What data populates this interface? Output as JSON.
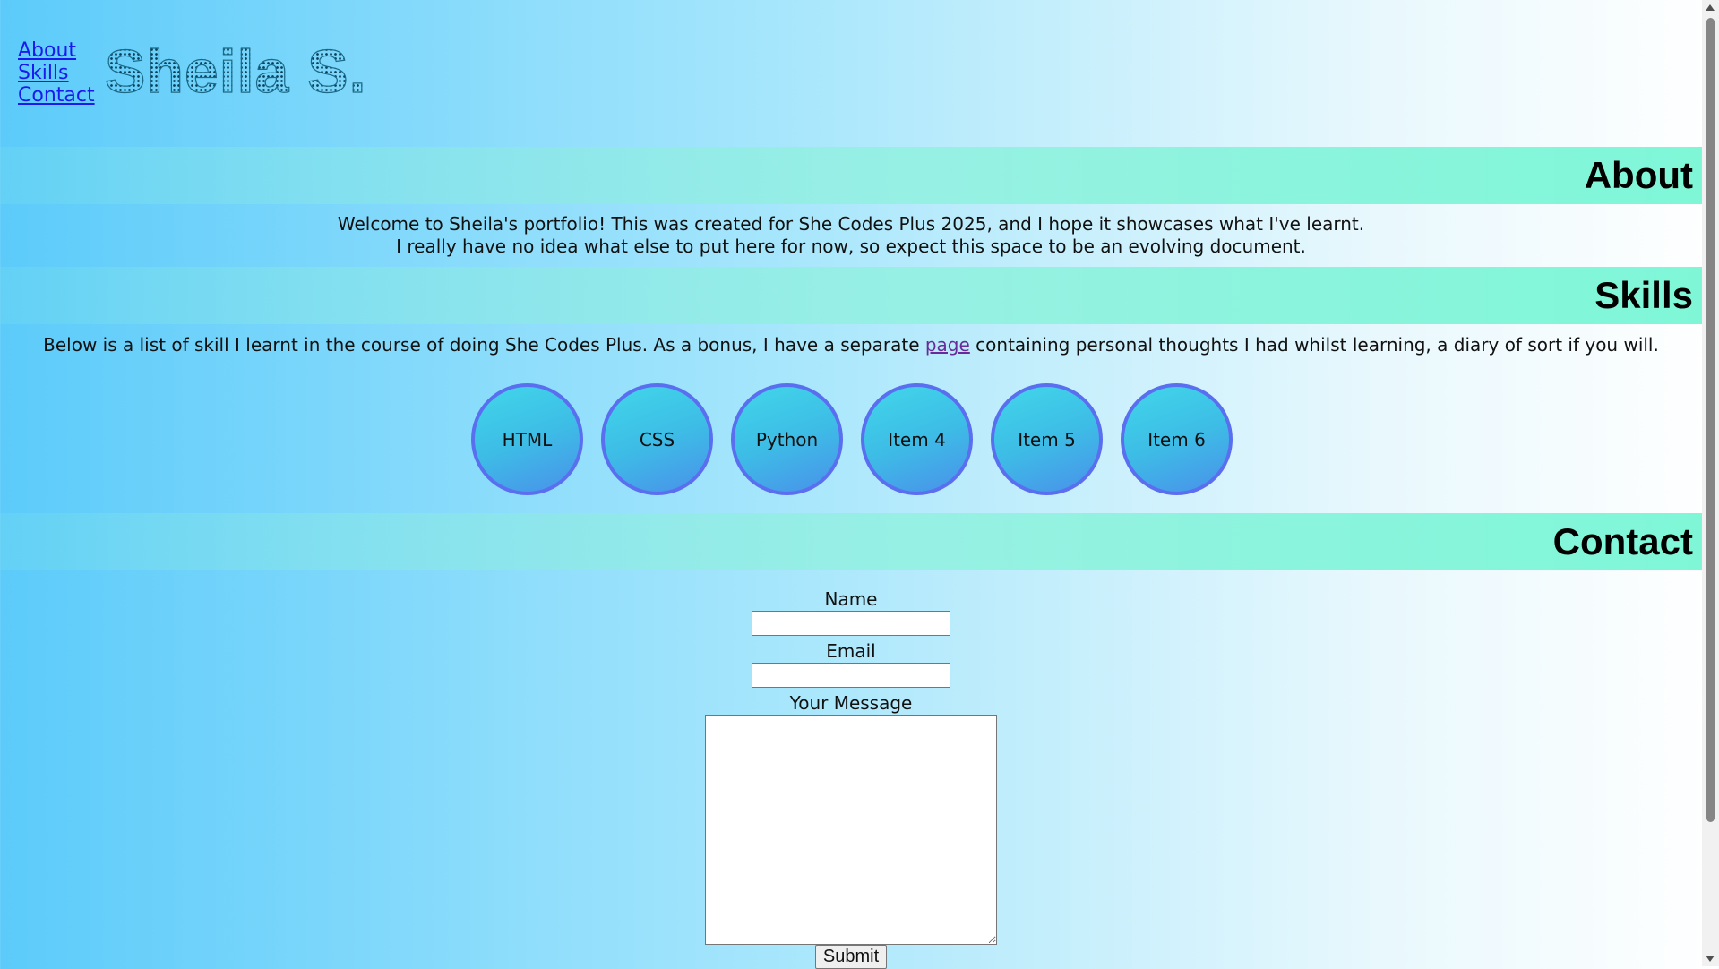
{
  "nav": {
    "items": [
      {
        "label": "About"
      },
      {
        "label": "Skills"
      },
      {
        "label": "Contact"
      }
    ]
  },
  "logo": {
    "text": "Sheila S."
  },
  "about": {
    "heading": "About",
    "line1": "Welcome to Sheila's portfolio! This was created for She Codes Plus 2025, and I hope it showcases what I've learnt.",
    "line2": "I really have no idea what else to put here for now, so expect this space to be an evolving document."
  },
  "skills": {
    "heading": "Skills",
    "text_before": "Below is a list of skill I learnt in the course of doing She Codes Plus. As a bonus, I have a separate ",
    "link_label": "page",
    "text_after": " containing personal thoughts I had whilst learning, a diary of sort if you will.",
    "items": [
      "HTML",
      "CSS",
      "Python",
      "Item 4",
      "Item 5",
      "Item 6"
    ]
  },
  "contact": {
    "heading": "Contact",
    "name_label": "Name",
    "name_value": "",
    "email_label": "Email",
    "email_value": "",
    "message_label": "Your Message",
    "message_value": "",
    "submit_label": "Submit"
  },
  "colors": {
    "banner": "#8ef3de",
    "bubble_border": "#5a6ff0",
    "link": "#1a1aee",
    "visited_link": "#6a2b9a"
  }
}
